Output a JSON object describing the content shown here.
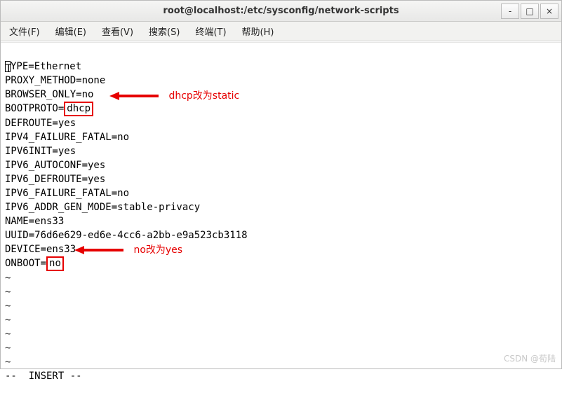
{
  "title": "root@localhost:/etc/sysconfig/network-scripts",
  "win": {
    "min": "-",
    "max": "□",
    "close": "×"
  },
  "menus": [
    "文件(F)",
    "编辑(E)",
    "查看(V)",
    "搜索(S)",
    "终端(T)",
    "帮助(H)"
  ],
  "lines": {
    "l1_pre": "",
    "l1_first": "T",
    "l1_post": "YPE=Ethernet",
    "l2": "PROXY_METHOD=none",
    "l3": "BROWSER_ONLY=no",
    "l4_pre": "BOOTPROTO=",
    "l4_box": "dhcp",
    "l5": "DEFROUTE=yes",
    "l6": "IPV4_FAILURE_FATAL=no",
    "l7": "IPV6INIT=yes",
    "l8": "IPV6_AUTOCONF=yes",
    "l9": "IPV6_DEFROUTE=yes",
    "l10": "IPV6_FAILURE_FATAL=no",
    "l11": "IPV6_ADDR_GEN_MODE=stable-privacy",
    "l12": "NAME=ens33",
    "l13": "UUID=76d6e629-ed6e-4cc6-a2bb-e9a523cb3118",
    "l14": "DEVICE=ens33",
    "l15_pre": "ONBOOT=",
    "l15_box": "no",
    "tilde": "~"
  },
  "annotations": {
    "a1": "dhcp改为static",
    "a2": "no改为yes"
  },
  "status": "--  INSERT --",
  "watermark": "CSDN @荀陆"
}
